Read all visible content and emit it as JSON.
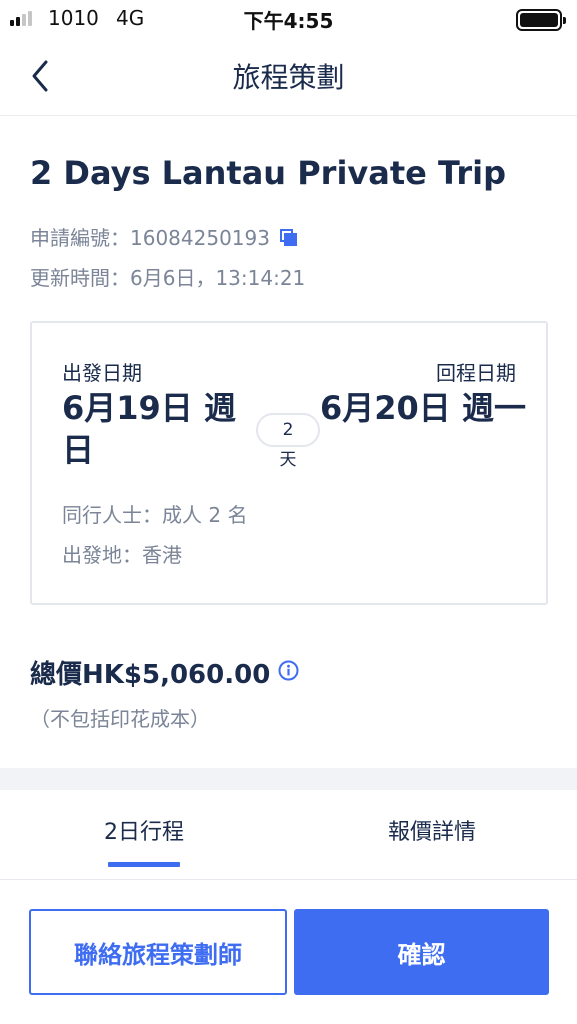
{
  "status_bar": {
    "carrier": "1010",
    "network": "4G",
    "time": "下午4:55",
    "signal_bars": 4,
    "signal_bars_active": 2
  },
  "nav": {
    "title": "旅程策劃",
    "back_icon": "chevron-left-icon"
  },
  "trip": {
    "title": "2 Days Lantau Private Trip",
    "reference_label": "申請編號：16084250193",
    "copy_icon": "copy-icon",
    "updated_label": "更新時間：6月6日，13:14:21"
  },
  "dates": {
    "departure_label": "出發日期",
    "departure_date": "6月19日 週日",
    "return_label": "回程日期",
    "return_date": "6月20日 週一",
    "days_count": "2",
    "days_unit": "天",
    "companions": "同行人士：成人 2 名",
    "origin": "出發地：香港"
  },
  "price": {
    "total": "總價HK$5,060.00",
    "info_icon": "info-icon",
    "note": "（不包括印花成本）"
  },
  "tabs": [
    {
      "label": "2日行程",
      "active": true
    },
    {
      "label": "報價詳情",
      "active": false
    }
  ],
  "actions": {
    "contact_label": "聯絡旅程策劃師",
    "confirm_label": "確認"
  },
  "colors": {
    "primary": "#3f6df2",
    "text_dark": "#1a2b4c",
    "text_muted": "#7b8597",
    "border": "#e3e6ec"
  }
}
